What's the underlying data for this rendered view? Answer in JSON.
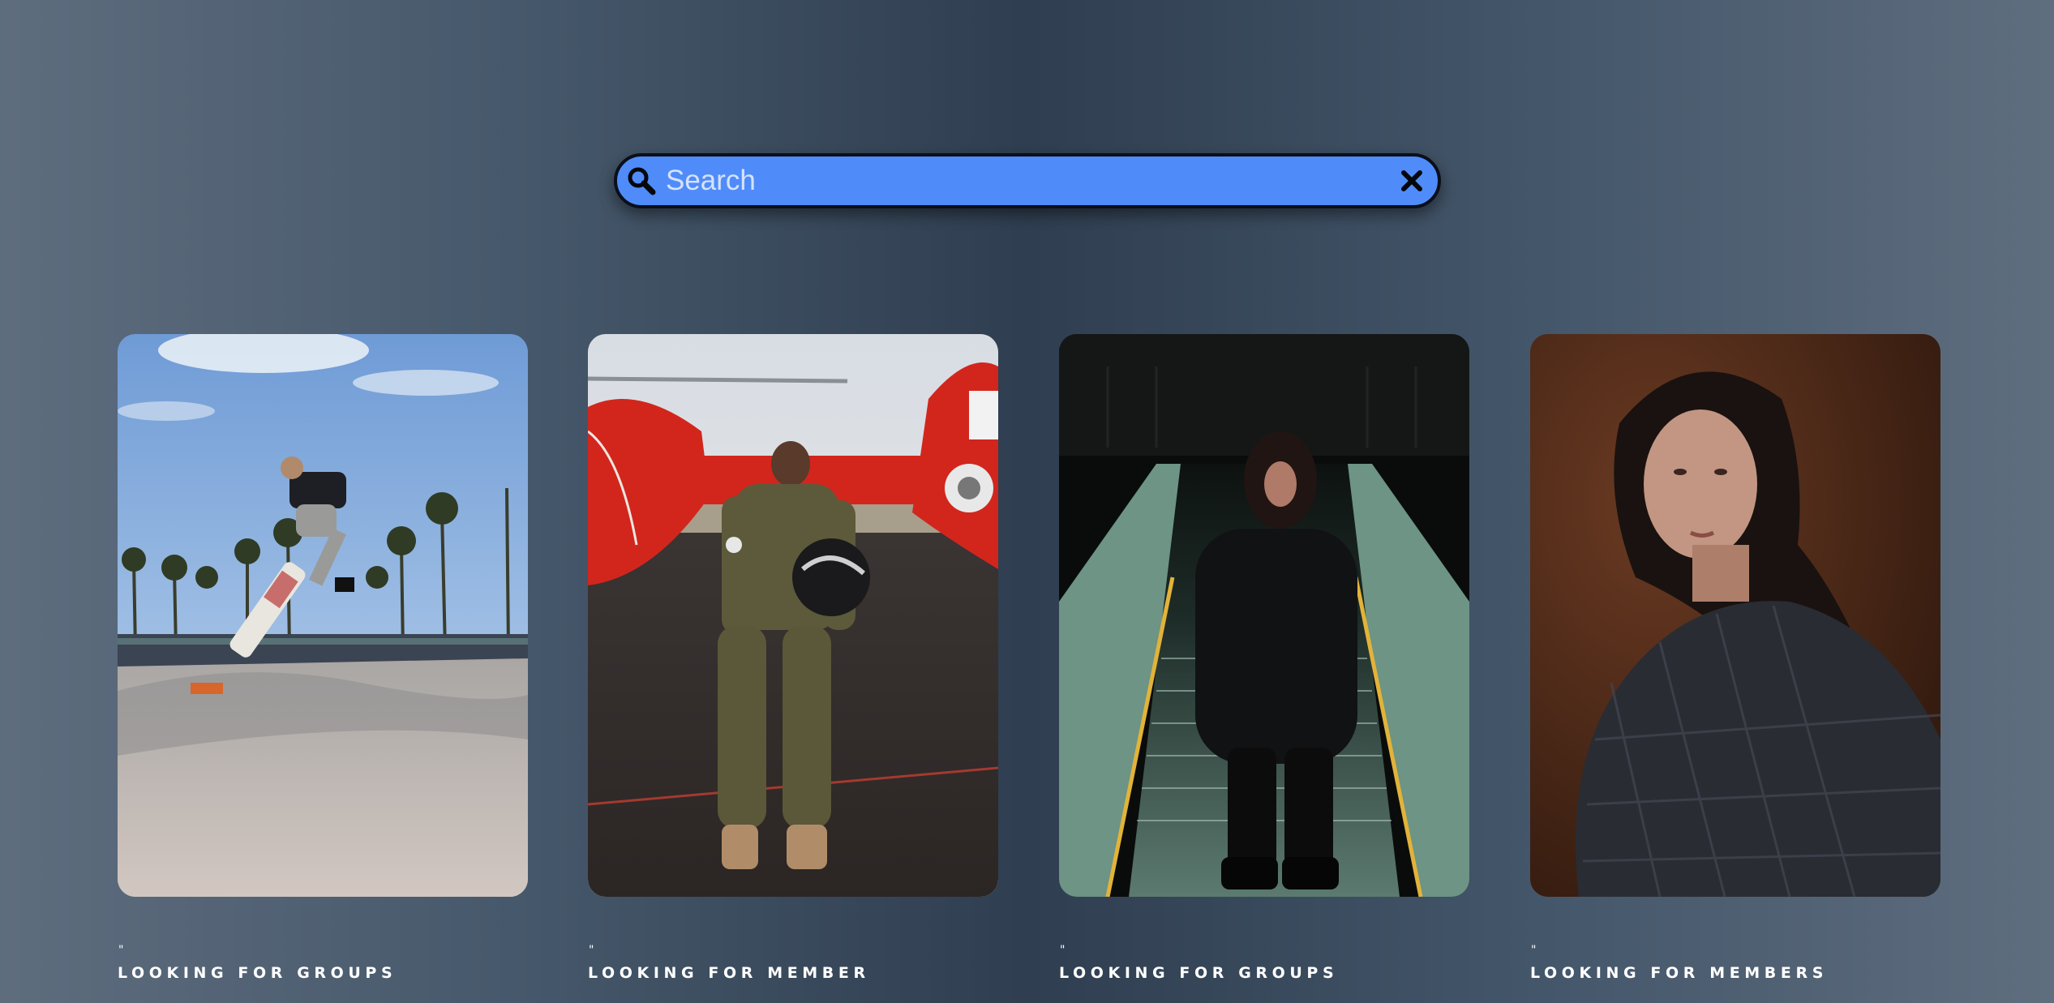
{
  "search": {
    "placeholder": "Search",
    "value": "",
    "background_color": "#4f8cf9"
  },
  "cards": [
    {
      "quote": "\"",
      "label": "LOOKING FOR GROUPS",
      "image": "skateboarder-photo"
    },
    {
      "quote": "\"",
      "label": "LOOKING FOR MEMBER",
      "image": "pilot-helicopter-photo"
    },
    {
      "quote": "\"",
      "label": "LOOKING FOR GROUPS",
      "image": "woman-escalator-photo"
    },
    {
      "quote": "\"",
      "label": "LOOKING FOR MEMBERS",
      "image": "woman-portrait-photo"
    }
  ],
  "icons": {
    "search": "search-icon",
    "close": "close-icon"
  }
}
